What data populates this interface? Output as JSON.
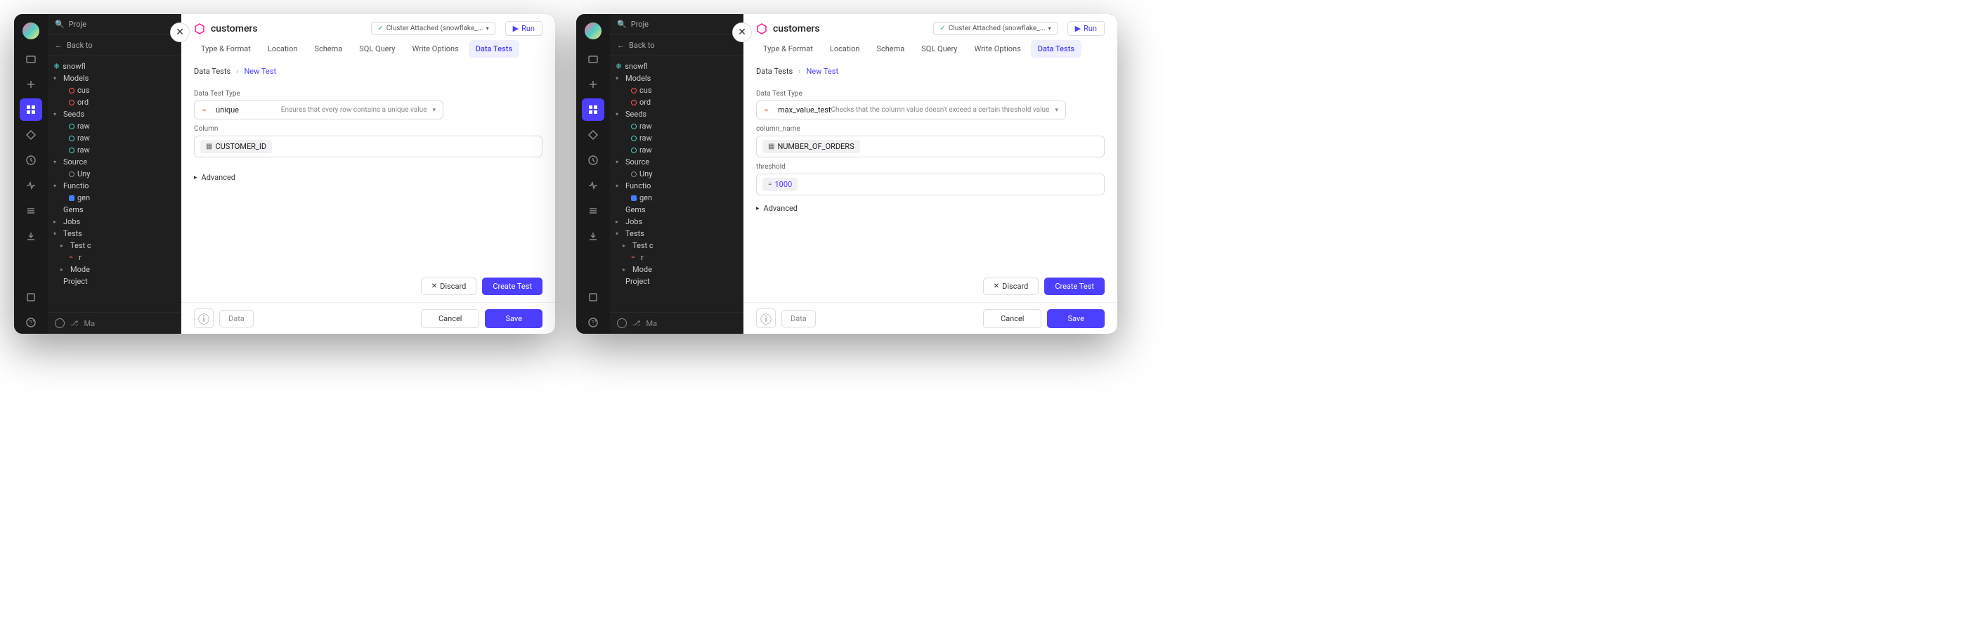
{
  "windows": [
    {
      "title": "customers",
      "cluster_label": "Cluster Attached (snowflake_...",
      "run_label": "Run",
      "proj_label": "Proje",
      "back_label": "Back to",
      "snowflake_label": "snowfl",
      "tree": {
        "models": "Models",
        "cus": "cus",
        "ord": "ord",
        "seeds": "Seeds",
        "raw1": "raw",
        "raw2": "raw",
        "raw3": "raw",
        "sources": "Source",
        "uny": "Uny",
        "functions": "Functio",
        "gen": "gen",
        "gems": "Gems",
        "jobs": "Jobs",
        "tests": "Tests",
        "testc": "Test c",
        "r": "r",
        "mode": "Mode",
        "project": "Project"
      },
      "footer_ma": "Ma",
      "tabs": [
        "Type & Format",
        "Location",
        "Schema",
        "SQL Query",
        "Write Options",
        "Data Tests"
      ],
      "active_tab": 5,
      "bc_tests": "Data Tests",
      "bc_new": "New Test",
      "type_label": "Data Test Type",
      "type_value": "unique",
      "type_desc": "Ensures that every row contains a unique value",
      "col_label": "Column",
      "col_value": "CUSTOMER_ID",
      "has_threshold": false,
      "threshold_label": "",
      "threshold_value": "",
      "advanced": "Advanced",
      "discard": "Discard",
      "create": "Create Test",
      "data_btn": "Data",
      "cancel": "Cancel",
      "save": "Save"
    },
    {
      "title": "customers",
      "cluster_label": "Cluster Attached (snowflake_...",
      "run_label": "Run",
      "proj_label": "Proje",
      "back_label": "Back to",
      "snowflake_label": "snowfl",
      "tree": {
        "models": "Models",
        "cus": "cus",
        "ord": "ord",
        "seeds": "Seeds",
        "raw1": "raw",
        "raw2": "raw",
        "raw3": "raw",
        "sources": "Source",
        "uny": "Uny",
        "functions": "Functio",
        "gen": "gen",
        "gems": "Gems",
        "jobs": "Jobs",
        "tests": "Tests",
        "testc": "Test c",
        "r": "r",
        "mode": "Mode",
        "project": "Project"
      },
      "footer_ma": "Ma",
      "tabs": [
        "Type & Format",
        "Location",
        "Schema",
        "SQL Query",
        "Write Options",
        "Data Tests"
      ],
      "active_tab": 5,
      "bc_tests": "Data Tests",
      "bc_new": "New Test",
      "type_label": "Data Test Type",
      "type_value": "max_value_test",
      "type_desc": "Checks that the column value doesn't exceed a certain threshold value",
      "col_label": "column_name",
      "col_value": "NUMBER_OF_ORDERS",
      "has_threshold": true,
      "threshold_label": "threshold",
      "threshold_value": "1000",
      "advanced": "Advanced",
      "discard": "Discard",
      "create": "Create Test",
      "data_btn": "Data",
      "cancel": "Cancel",
      "save": "Save"
    }
  ]
}
